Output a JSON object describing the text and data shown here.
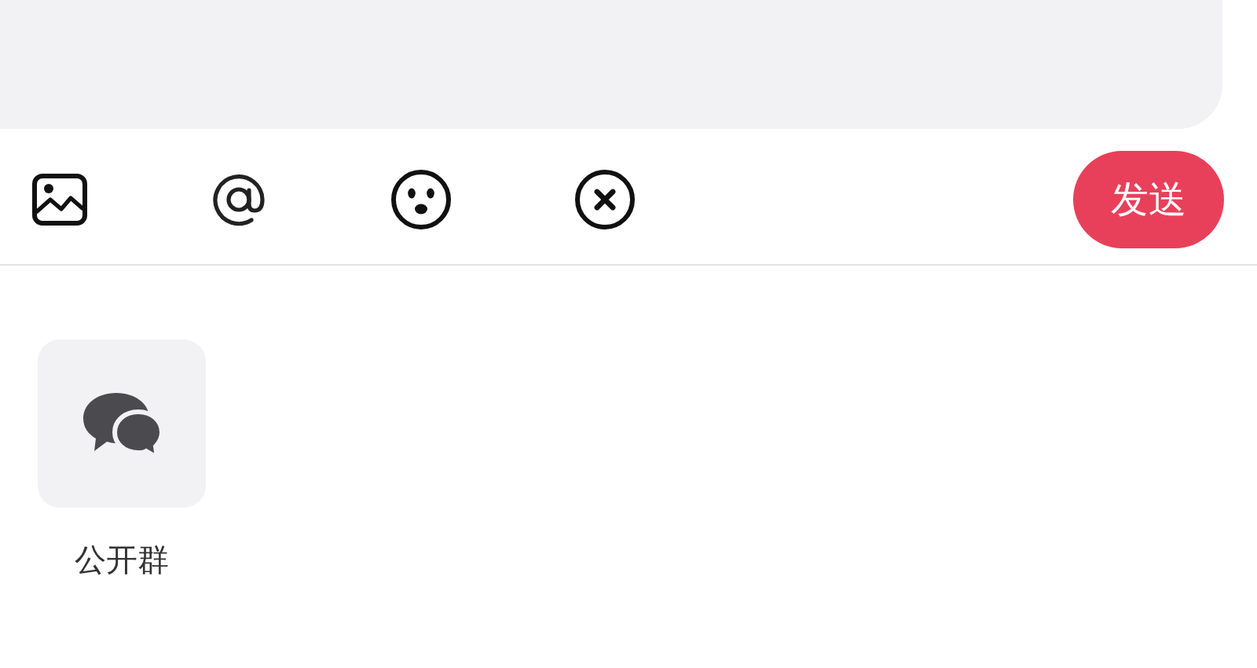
{
  "toolbar": {
    "tools": [
      {
        "kind": "image"
      },
      {
        "kind": "mention"
      },
      {
        "kind": "emoji"
      },
      {
        "kind": "clear"
      }
    ],
    "send_button": "发送"
  },
  "shortcuts": [
    {
      "kind": "group-chat",
      "label": "公开群"
    }
  ]
}
